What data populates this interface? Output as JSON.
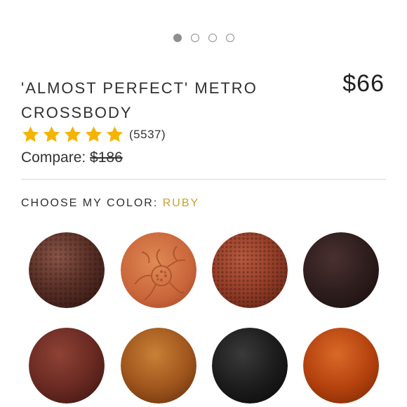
{
  "pager": {
    "total": 4,
    "active_index": 0
  },
  "product": {
    "title": "'ALMOST PERFECT' METRO CROSSBODY",
    "price": "$66",
    "rating": {
      "stars": 5,
      "max_stars": 5,
      "review_count": "(5537)",
      "star_color": "#f5b400"
    },
    "compare_label": "Compare:",
    "compare_price": "$186"
  },
  "color_picker": {
    "heading": "CHOOSE MY COLOR:",
    "selected": "RUBY",
    "selected_color": "#c8a031",
    "swatches": [
      {
        "name": "pebbled-dark-brown",
        "color": "#5c3128"
      },
      {
        "name": "floral-embossed-tan",
        "color": "#c9653a"
      },
      {
        "name": "pebbled-ruby",
        "color": "#923d28"
      },
      {
        "name": "dark-chocolate",
        "color": "#2e1d1d"
      },
      {
        "name": "ruby",
        "color": "#6a2a22"
      },
      {
        "name": "cognac",
        "color": "#a0561d"
      },
      {
        "name": "black",
        "color": "#1c1c1c"
      },
      {
        "name": "burnt-orange",
        "color": "#b5420e"
      }
    ]
  }
}
